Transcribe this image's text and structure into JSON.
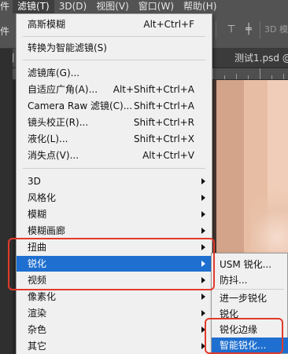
{
  "menubar": {
    "items": [
      {
        "label": "件"
      },
      {
        "label": "滤镜(T)",
        "active": true
      },
      {
        "label": "3D(D)"
      },
      {
        "label": "视图(V)"
      },
      {
        "label": "窗口(W)"
      },
      {
        "label": "帮助(H)"
      }
    ]
  },
  "options_bar": {
    "left_label": "件",
    "mode_3d_label": "3D 模"
  },
  "tabs": [
    {
      "label": "测",
      "close": ""
    },
    {
      "label": "测试1.psd @",
      "close": "×"
    }
  ],
  "filter_menu": {
    "items": [
      {
        "label": "高斯模糊",
        "shortcut": "Alt+Ctrl+F"
      },
      {
        "label": "转换为智能滤镜(S)",
        "shortcut": ""
      },
      {
        "label": "滤镜库(G)...",
        "shortcut": ""
      },
      {
        "label": "自适应广角(A)...",
        "shortcut": "Alt+Shift+Ctrl+A"
      },
      {
        "label": "Camera Raw 滤镜(C)...",
        "shortcut": "Shift+Ctrl+A"
      },
      {
        "label": "镜头校正(R)...",
        "shortcut": "Shift+Ctrl+R"
      },
      {
        "label": "液化(L)...",
        "shortcut": "Shift+Ctrl+X"
      },
      {
        "label": "消失点(V)...",
        "shortcut": "Alt+Ctrl+V"
      },
      {
        "label": "3D",
        "submenu": true
      },
      {
        "label": "风格化",
        "submenu": true
      },
      {
        "label": "模糊",
        "submenu": true
      },
      {
        "label": "模糊画廊",
        "submenu": true
      },
      {
        "label": "扭曲",
        "submenu": true
      },
      {
        "label": "锐化",
        "submenu": true,
        "highlighted": true
      },
      {
        "label": "视频",
        "submenu": true
      },
      {
        "label": "像素化",
        "submenu": true
      },
      {
        "label": "渲染",
        "submenu": true
      },
      {
        "label": "杂色",
        "submenu": true
      },
      {
        "label": "其它",
        "submenu": true
      }
    ]
  },
  "sharpen_submenu": {
    "items": [
      {
        "label": "USM 锐化..."
      },
      {
        "label": "防抖..."
      },
      {
        "label": "进一步锐化"
      },
      {
        "label": "锐化"
      },
      {
        "label": "锐化边缘"
      },
      {
        "label": "智能锐化...",
        "highlighted": true
      }
    ]
  },
  "colors": {
    "highlight": "#1e6fd0",
    "annotation_red": "#e23a2a",
    "menu_bg": "#f0f0f0",
    "menubar_bg": "#535353"
  }
}
